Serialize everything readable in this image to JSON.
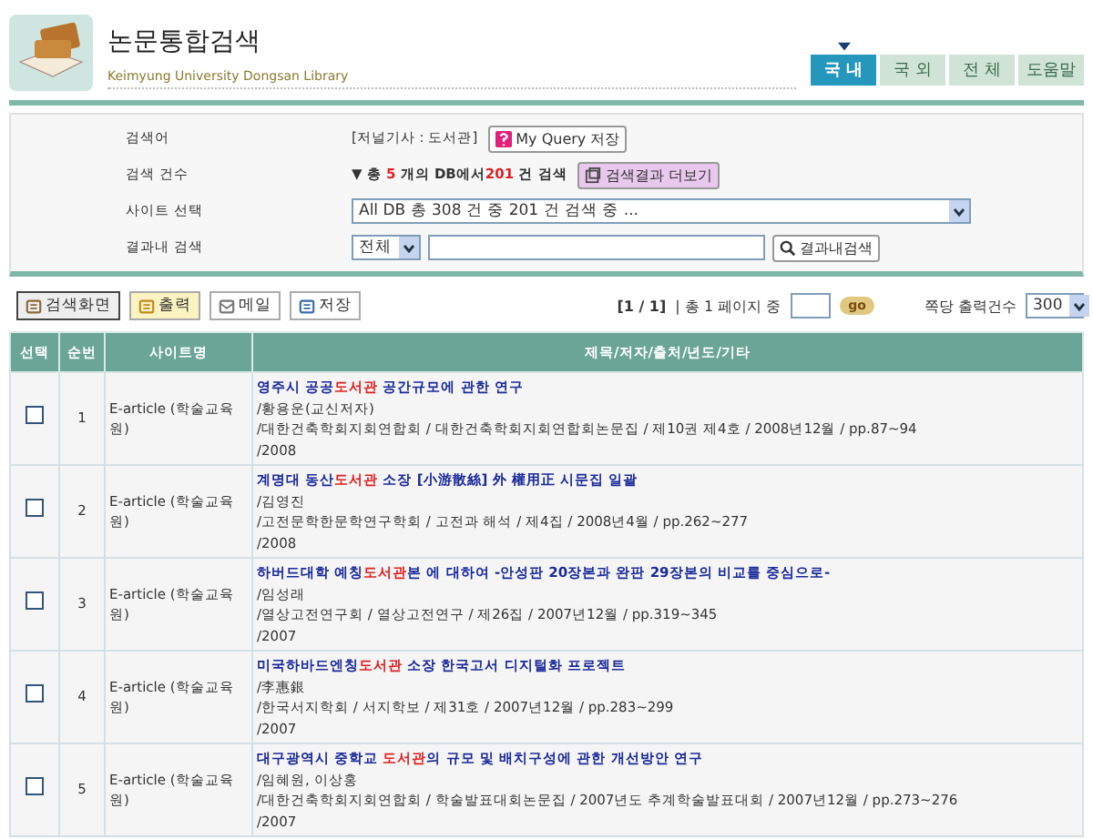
{
  "header": {
    "title": "논문통합검색",
    "subtitle": "Keimyung University Dongsan Library"
  },
  "tabs": [
    {
      "label": "국 내",
      "selected": true
    },
    {
      "label": "국 외",
      "selected": false
    },
    {
      "label": "전 체",
      "selected": false
    },
    {
      "label": "도움말",
      "selected": false
    }
  ],
  "search_panel": {
    "query_label": "검색어",
    "query": "[저널기사 : 도서관]",
    "save_query_button": "My Query 저장",
    "count_label": "검색 건수",
    "count_parts": [
      {
        "text": "▼ 총 ",
        "red": false
      },
      {
        "text": "5",
        "red": true
      },
      {
        "text": " 개의 DB에서",
        "red": false
      },
      {
        "text": "201",
        "red": true
      },
      {
        "text": " 건 검색",
        "red": false
      }
    ],
    "more_button": "검색결과 더보기",
    "site_label": "사이트 선택",
    "site_value": "All DB 총 308 건 중 201 건 검색 중 ...",
    "refine_label": "결과내 검색",
    "refine_scope": "전체",
    "refine_button": "결과내검색"
  },
  "toolbar": {
    "buttons": [
      {
        "label": "검색화면",
        "kind": "home"
      },
      {
        "label": "출력",
        "kind": "print"
      },
      {
        "label": "메일",
        "kind": "mail"
      },
      {
        "label": "저장",
        "kind": "save"
      }
    ],
    "page_info": "[1 / 1]",
    "page_total": "| 총 1 페이지 중",
    "go_button": "go",
    "per_page_label": "쪽당 출력건수",
    "per_page": "300"
  },
  "table": {
    "columns": [
      "선택",
      "순번",
      "사이트명",
      "제목/저자/출처/년도/기타"
    ],
    "rows": [
      {
        "checked": false,
        "number": "1",
        "site": "E-article (학술교육원)",
        "title": [
          {
            "text": "영주시 공공",
            "highlight": false
          },
          {
            "text": "도서관",
            "highlight": true
          },
          {
            "text": " 공간규모에 관한 연구",
            "highlight": false
          }
        ],
        "author": "/황용운(교신저자)",
        "source": "/대한건축학회지회연합회 / 대한건축학회지회연합회논문집 / 제10권 제4호 / 2008년12월 / pp.87~94",
        "year": "/2008"
      },
      {
        "checked": false,
        "number": "2",
        "site": "E-article (학술교육원)",
        "title": [
          {
            "text": "계명대 동산",
            "highlight": false
          },
          {
            "text": "도서관",
            "highlight": true
          },
          {
            "text": " 소장 [小游散絲] 外 權用正 시문집 일괄",
            "highlight": false
          }
        ],
        "author": "/김영진",
        "source": "/고전문학한문학연구학회 / 고전과 해석 / 제4집 / 2008년4월 / pp.262~277",
        "year": "/2008"
      },
      {
        "checked": false,
        "number": "3",
        "site": "E-article (학술교육원)",
        "title": [
          {
            "text": "하버드대학 예칭",
            "highlight": false
          },
          {
            "text": "도서관",
            "highlight": true
          },
          {
            "text": "본 에 대하여 -안성판 20장본과 완판 29장본의 비교를 중심으로-",
            "highlight": false
          }
        ],
        "author": "/임성래",
        "source": "/열상고전연구회 / 열상고전연구 / 제26집 / 2007년12월 / pp.319~345",
        "year": "/2007"
      },
      {
        "checked": false,
        "number": "4",
        "site": "E-article (학술교육원)",
        "title": [
          {
            "text": "미국하바드엔칭",
            "highlight": false
          },
          {
            "text": "도서관",
            "highlight": true
          },
          {
            "text": " 소장 한국고서 디지털화 프로젝트",
            "highlight": false
          }
        ],
        "author": "/李惠銀",
        "source": "/한국서지학회 / 서지학보 / 제31호 / 2007년12월 / pp.283~299",
        "year": "/2007"
      },
      {
        "checked": false,
        "number": "5",
        "site": "E-article (학술교육원)",
        "title": [
          {
            "text": "대구광역시 중학교 ",
            "highlight": false
          },
          {
            "text": "도서관",
            "highlight": true
          },
          {
            "text": "의 규모 및 배치구성에 관한 개선방안 연구",
            "highlight": false
          }
        ],
        "author": "/임혜원, 이상홍",
        "source": "/대한건축학회지회연합회 / 학술발표대회논문집 / 2007년도 추계학술발표대회 / 2007년12월 / pp.273~276",
        "year": "/2007"
      }
    ]
  }
}
